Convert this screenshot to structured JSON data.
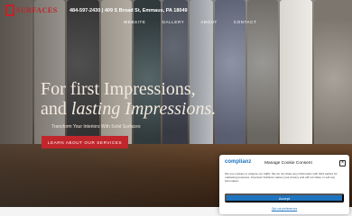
{
  "brand": {
    "logo_text": "SURFACES",
    "accent_color": "#c62127"
  },
  "header": {
    "contact_line": "484-597-2430 | 409 S Broad St, Emmaus, PA 18049"
  },
  "nav": {
    "items": [
      "WEBSITE",
      "GALLERY",
      "ABOUT",
      "CONTACT"
    ]
  },
  "hero": {
    "headline_line1": "For first Impressions,",
    "headline_line2_prefix": "and ",
    "headline_line2_italic": "lasting Impressions.",
    "subline": "Transform Your Interiors With Solid Surfaces",
    "cta_label": "LEARN ABOUT OUR SERVICES",
    "cta_color": "#c0262b"
  },
  "cookie_modal": {
    "logo": "complianz",
    "logo_sub": "",
    "title": "Manage Cookie Consent",
    "close_icon": "close-icon",
    "body": "We use cookies to analyze our traffic. We do not share any information with third parties for marketing purposes. American Surfaces values your privacy and will not share or sell any information.",
    "accept_label": "Accept",
    "link_label": "Opt-out preferences",
    "accent_color": "#1e73be"
  }
}
